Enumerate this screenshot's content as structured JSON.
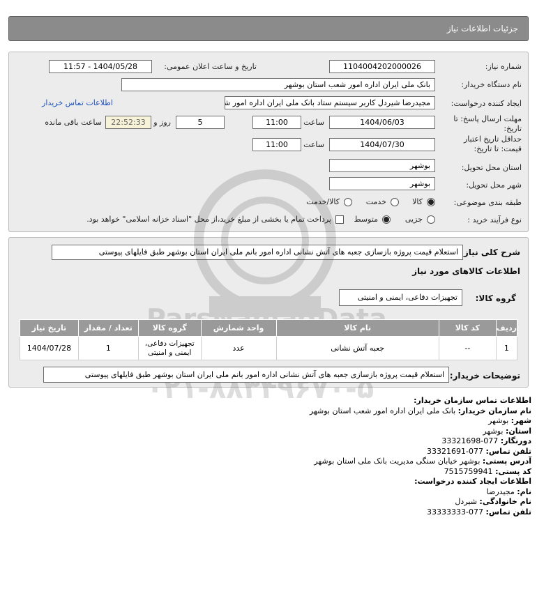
{
  "header": {
    "title": "جزئیات اطلاعات نیاز"
  },
  "form": {
    "need_number_label": "شماره نیاز:",
    "need_number": "1104004202000026",
    "announce_label": "تاریخ و ساعت اعلان عمومی:",
    "announce_value": "1404/05/28 - 11:57",
    "buyer_label": "نام دستگاه خریدار:",
    "buyer_value": "بانک ملی ایران اداره امور شعب استان بوشهر",
    "creator_label": "ایجاد کننده درخواست:",
    "creator_value": "مجیدرضا شیردل کاربر سیستم ستاد بانک ملی ایران اداره امور شعب استان بوشهر",
    "contact_link": "اطلاعات تماس خریدار",
    "deadline_label": "مهلت ارسال پاسخ: تا تاریخ:",
    "deadline_date": "1404/06/03",
    "time_label": "ساعت",
    "deadline_time": "11:00",
    "days_value": "5",
    "days_label": "روز و",
    "remaining_time": "22:52:33",
    "remaining_label": "ساعت باقی مانده",
    "validity_label": "حداقل تاریخ اعتبار قیمت: تا تاریخ:",
    "validity_date": "1404/07/30",
    "validity_time": "11:00",
    "province_label": "استان محل تحویل:",
    "province_value": "بوشهر",
    "city_label": "شهر محل تحویل:",
    "city_value": "بوشهر",
    "category_label": "طبقه بندی موضوعی:",
    "category_options": [
      "کالا",
      "خدمت",
      "کالا/خدمت"
    ],
    "process_label": "نوع فرآیند خرید :",
    "process_options": [
      "جزیی",
      "متوسط"
    ],
    "payment_note": "پرداخت تمام یا بخشی از مبلغ خرید،از محل \"اسناد خزانه اسلامی\" خواهد بود."
  },
  "summary": {
    "label": "شرح کلی نیاز:",
    "value": "استعلام قیمت پروژه بازسازی جعبه های آتش نشانی اداره امور بانم ملی ایران استان بوشهر طبق فایلهای پیوستی"
  },
  "goods": {
    "section_title": "اطلاعات کالاهای مورد نیاز",
    "group_label": "گروه کالا:",
    "group_value": "تجهیزات دفاعی، ایمنی و امنیتی",
    "headers": [
      "ردیف",
      "کد کالا",
      "نام کالا",
      "واحد شمارش",
      "گروه کالا",
      "تعداد / مقدار",
      "تاریخ نیاز"
    ],
    "rows": [
      {
        "row": "1",
        "code": "--",
        "name": "جعبه آتش نشانی",
        "unit": "عدد",
        "group": "تجهیزات دفاعی، ایمنی و امنیتی",
        "qty": "1",
        "date": "1404/07/28"
      }
    ]
  },
  "buyer_notes": {
    "label": "توضیحات خریدار:",
    "value": "استعلام قیمت پروژه بازسازی جعبه های آتش نشانی اداره امور بانم ملی ایران استان بوشهر طبق فایلهای پیوستی"
  },
  "contact": {
    "title": "اطلاعات تماس سازمان خریدار:",
    "org_label": "نام سازمان خریدار:",
    "org_value": "بانک ملی ایران اداره امور شعب استان بوشهر",
    "city_label": "شهر:",
    "city_value": "بوشهر",
    "province_label": "استان:",
    "province_value": "بوشهر",
    "fax_label": "دورنگار:",
    "fax_value": "077-33321698",
    "phone_label": "تلفن تماس:",
    "phone_value": "077-33321691",
    "address_label": "آدرس پستی:",
    "address_value": "بوشهر خیابان سنگی مدیریت بانک ملی استان بوشهر",
    "postal_label": "کد پستی:",
    "postal_value": "7515759941",
    "creator_title": "اطلاعات ایجاد کننده درخواست:",
    "name_label": "نام:",
    "name_value": "مجیدرضا",
    "family_label": "نام خانوادگی:",
    "family_value": "شیردل",
    "creator_phone_label": "تلفن تماس:",
    "creator_phone_value": "077-33333333"
  },
  "watermark": {
    "brand": "ParsNamadData",
    "phone": "۰۲۱-۸۸۳۴۹۶۷۰-۵"
  }
}
